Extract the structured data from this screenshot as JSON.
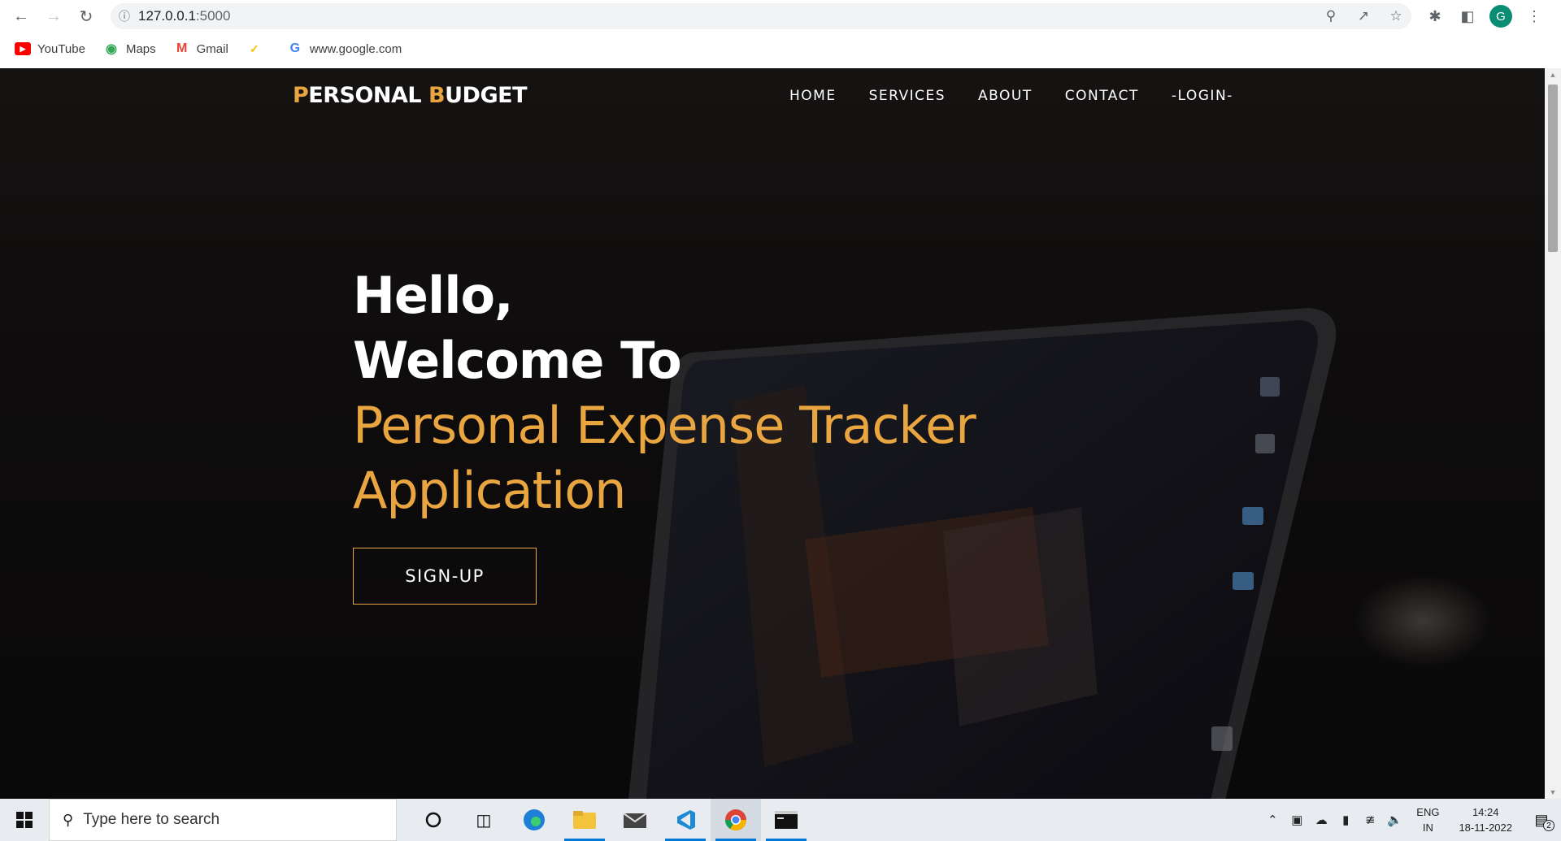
{
  "browser": {
    "url_host": "127.0.0.1",
    "url_port": ":5000",
    "avatar_letter": "G",
    "bookmarks": [
      {
        "label": "YouTube",
        "icon": "youtube-icon",
        "color": "#ff0000"
      },
      {
        "label": "Maps",
        "icon": "maps-icon",
        "color": "#34a853"
      },
      {
        "label": "Gmail",
        "icon": "gmail-icon",
        "color": "#ea4335"
      },
      {
        "label": "",
        "icon": "bookmark-app-icon",
        "color": "#f2c200"
      },
      {
        "label": "www.google.com",
        "icon": "google-icon",
        "color": "#4285f4"
      }
    ]
  },
  "site": {
    "brand_first_initial": "P",
    "brand_first_rest": "ERSONAL ",
    "brand_second_initial": "B",
    "brand_second_rest": "UDGET",
    "nav": [
      "HOME",
      "SERVICES",
      "ABOUT",
      "CONTACT",
      "-LOGIN-"
    ],
    "accent_color": "#e9a540"
  },
  "hero": {
    "line1": "Hello,",
    "line2": "Welcome To",
    "line3": "Personal Expense Tracker",
    "line4": "Application",
    "cta": "SIGN-UP"
  },
  "taskbar": {
    "search_placeholder": "Type here to search",
    "lang_line1": "ENG",
    "lang_line2": "IN",
    "time": "14:24",
    "date": "18-11-2022",
    "notification_count": "2"
  }
}
